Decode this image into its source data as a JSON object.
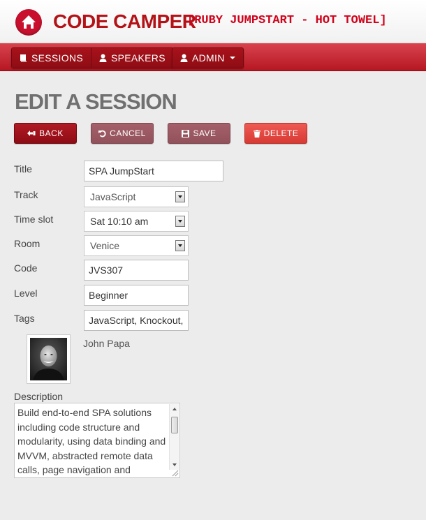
{
  "header": {
    "brand": "CODE CAMPER",
    "tagline": "[RUBY JUMPSTART - HOT TOWEL]",
    "brand_color": "#b31217",
    "logo_icon": "home-icon"
  },
  "nav": {
    "items": [
      {
        "label": "SESSIONS",
        "icon": "book-icon"
      },
      {
        "label": "SPEAKERS",
        "icon": "user-icon"
      }
    ],
    "admin": {
      "label": "ADMIN",
      "icon": "user-icon"
    }
  },
  "page": {
    "title": "EDIT A SESSION"
  },
  "actions": {
    "back": "BACK",
    "cancel": "CANCEL",
    "save": "SAVE",
    "delete": "DELETE"
  },
  "form": {
    "title": {
      "label": "Title",
      "value": "SPA JumpStart"
    },
    "track": {
      "label": "Track",
      "value": "JavaScript"
    },
    "timeslot": {
      "label": "Time slot",
      "value": "Sat 10:10 am"
    },
    "room": {
      "label": "Room",
      "value": "Venice"
    },
    "code": {
      "label": "Code",
      "value": "JVS307"
    },
    "level": {
      "label": "Level",
      "value": "Beginner"
    },
    "tags": {
      "label": "Tags",
      "value": "JavaScript, Knockout,"
    },
    "speaker": {
      "name": "John Papa"
    },
    "description": {
      "label": "Description",
      "value": "Build end-to-end SPA solutions including code structure and modularity, using data binding and MVVM, abstracted remote data calls, page navigation and"
    }
  },
  "colors": {
    "accent": "#c8102e",
    "navbar": "#b51722",
    "delete": "#d73a33"
  }
}
